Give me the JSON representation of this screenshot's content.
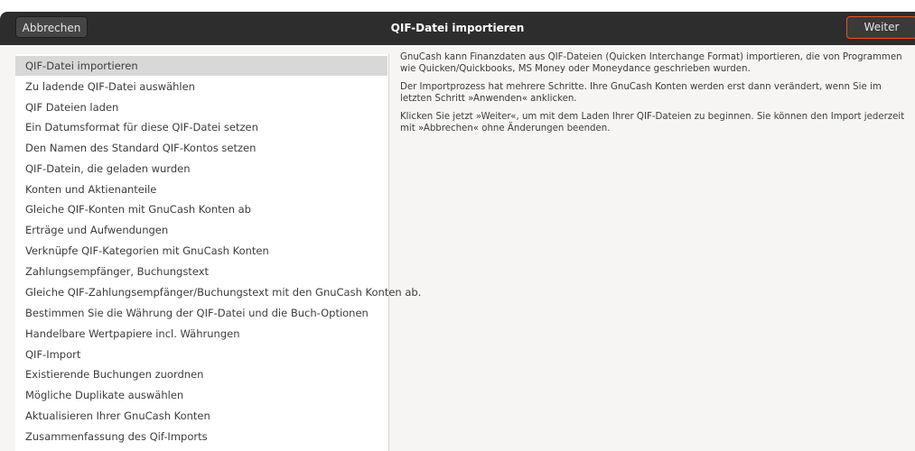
{
  "header": {
    "cancel_label": "Abbrechen",
    "title": "QIF-Datei importieren",
    "next_label": "Weiter"
  },
  "steps": [
    "QIF-Datei importieren",
    "Zu ladende QIF-Datei auswählen",
    "QIF Dateien laden",
    "Ein Datumsformat für diese QIF-Datei setzen",
    "Den Namen des Standard QIF-Kontos setzen",
    "QIF-Datein, die geladen wurden",
    "Konten und Aktienanteile",
    "Gleiche QIF-Konten mit GnuCash Konten ab",
    "Erträge und Aufwendungen",
    "Verknüpfe QIF-Kategorien mit GnuCash Konten",
    "Zahlungsempfänger, Buchungstext",
    "Gleiche QIF-Zahlungsempfänger/Buchungstext mit den GnuCash Konten ab.",
    "Bestimmen Sie die Währung der QIF-Datei und die Buch-Optionen",
    "Handelbare Wertpapiere incl. Währungen",
    "QIF-Import",
    "Existierende Buchungen zuordnen",
    "Mögliche Duplikate auswählen",
    "Aktualisieren Ihrer GnuCash Konten",
    "Zusammenfassung des Qif-Imports"
  ],
  "content": {
    "paragraphs": [
      "GnuCash kann Finanzdaten aus QIF-Dateien (Quicken Interchange Format) importieren, die von Programmen wie Quicken/Quickbooks, MS Money oder Moneydance geschrieben wurden.",
      "Der Importprozess hat mehrere Schritte. Ihre GnuCash Konten werden erst dann verändert, wenn Sie im letzten Schritt »Anwenden« anklicken.",
      "Klicken Sie jetzt »Weiter«, um mit dem Laden Ihrer QIF-Dateien zu beginnen. Sie können den Import jederzeit mit »Abbrechen« ohne Änderungen beenden."
    ]
  },
  "colors": {
    "headerbar": "#2d2d2d",
    "accent": "#e95420",
    "selected_row": "#d8d8d8"
  }
}
